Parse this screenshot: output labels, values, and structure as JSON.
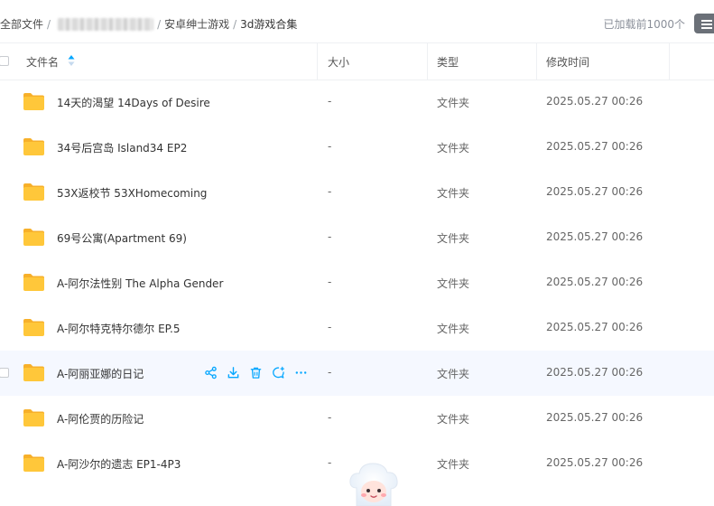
{
  "breadcrumb": {
    "root": "全部文件",
    "sep": "/",
    "level2": "安卓绅士游戏",
    "current": "3d游戏合集"
  },
  "loaded_count": "已加载前1000个",
  "columns": {
    "name": "文件名",
    "size": "大小",
    "type": "类型",
    "modified": "修改时间"
  },
  "files": [
    {
      "name": "14天的渴望 14Days of Desire",
      "size": "-",
      "type": "文件夹",
      "modified": "2025.05.27 00:26"
    },
    {
      "name": "34号后宫岛 Island34 EP2",
      "size": "-",
      "type": "文件夹",
      "modified": "2025.05.27 00:26"
    },
    {
      "name": "53X返校节 53XHomecoming",
      "size": "-",
      "type": "文件夹",
      "modified": "2025.05.27 00:26"
    },
    {
      "name": "69号公寓(Apartment 69)",
      "size": "-",
      "type": "文件夹",
      "modified": "2025.05.27 00:26"
    },
    {
      "name": "A-阿尔法性别 The Alpha Gender",
      "size": "-",
      "type": "文件夹",
      "modified": "2025.05.27 00:26"
    },
    {
      "name": "A-阿尔特克特尔德尔 EP.5",
      "size": "-",
      "type": "文件夹",
      "modified": "2025.05.27 00:26"
    },
    {
      "name": "A-阿丽亚娜的日记",
      "size": "-",
      "type": "文件夹",
      "modified": "2025.05.27 00:26"
    },
    {
      "name": "A-阿伦贾的历险记",
      "size": "-",
      "type": "文件夹",
      "modified": "2025.05.27 00:26"
    },
    {
      "name": "A-阿沙尔的遗志 EP1-4P3",
      "size": "-",
      "type": "文件夹",
      "modified": "2025.05.27 00:26"
    }
  ],
  "icons": {
    "folder": "folder-icon",
    "share": "share-icon",
    "download": "download-icon",
    "delete": "trash-icon",
    "comment": "comment-icon",
    "more": "more-icon",
    "sort": "sort-ascending-icon",
    "view": "list-view-icon"
  },
  "colors": {
    "accent": "#06a7ff",
    "folder": "#ffc73a",
    "folder_tab": "#f7b02a",
    "hover_row": "#f5f8ff"
  }
}
